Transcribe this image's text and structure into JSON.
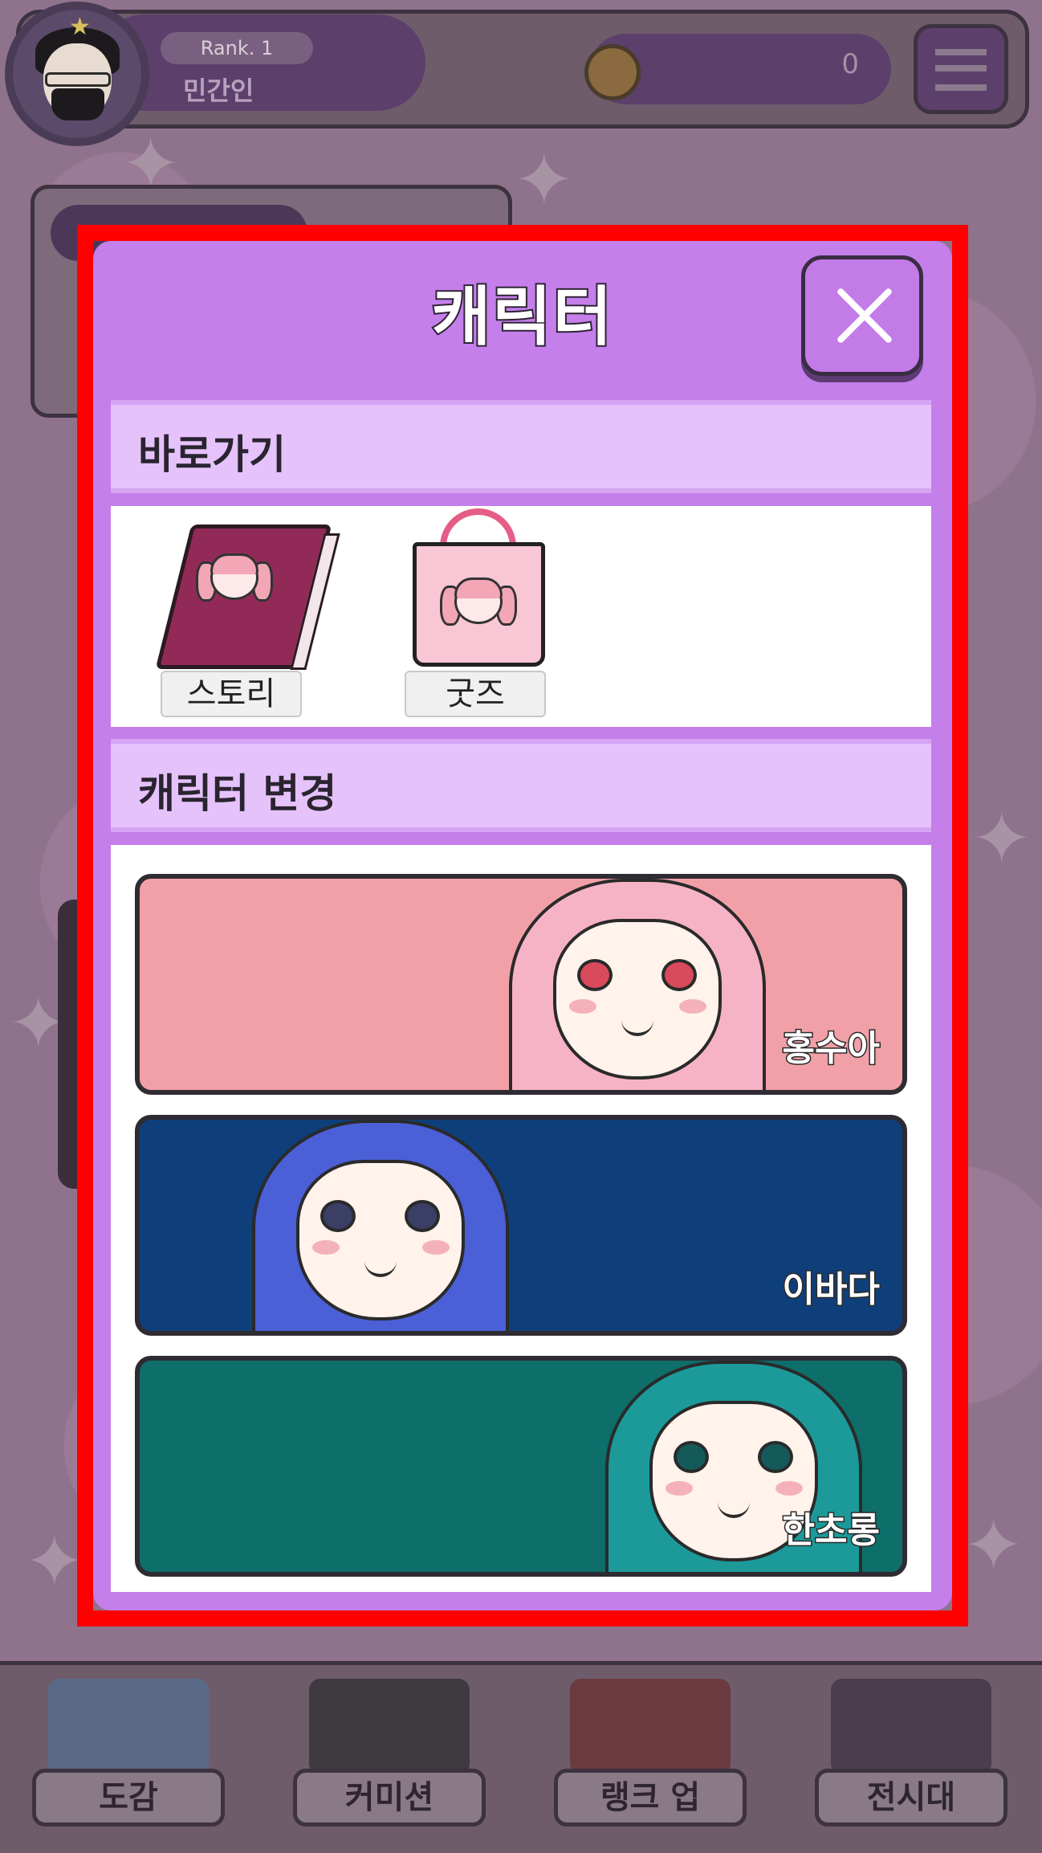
{
  "header": {
    "rank_label": "Rank. 1",
    "rank_title": "민간인",
    "coin_value": "0"
  },
  "modal": {
    "title": "캐릭터",
    "shortcuts_header": "바로가기",
    "shortcuts": [
      {
        "label": "스토리",
        "icon": "story-book-icon"
      },
      {
        "label": "굿즈",
        "icon": "goods-bag-icon"
      }
    ],
    "change_header": "캐릭터 변경",
    "characters": [
      {
        "name": "홍수아",
        "theme": "#f2a0a8",
        "hair": "#f7b3c6",
        "eye": "#d94a5c"
      },
      {
        "name": "이바다",
        "theme": "#0f3f7a",
        "hair": "#4b5fd6",
        "eye": "#3b3f66"
      },
      {
        "name": "한초롱",
        "theme": "#0d6e6a",
        "hair": "#1c9a9a",
        "eye": "#155a5a"
      }
    ]
  },
  "bottom_nav": [
    {
      "label": "도감"
    },
    {
      "label": "커미션"
    },
    {
      "label": "랭크 업"
    },
    {
      "label": "전시대"
    }
  ],
  "colors": {
    "modal_bg": "#c47fea",
    "section_header_bg": "#e6c2fb",
    "highlight_frame": "#ff0000"
  }
}
